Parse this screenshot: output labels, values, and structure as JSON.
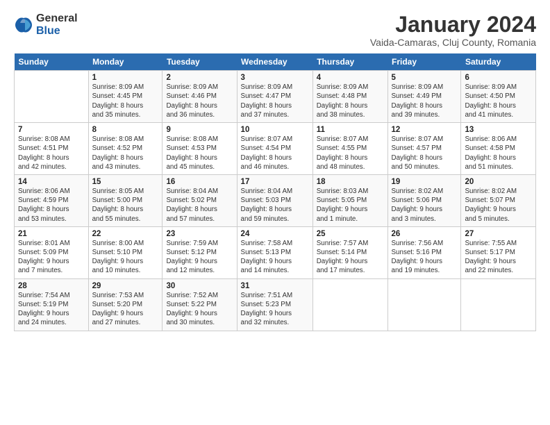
{
  "logo": {
    "general": "General",
    "blue": "Blue"
  },
  "title": "January 2024",
  "subtitle": "Vaida-Camaras, Cluj County, Romania",
  "days_header": [
    "Sunday",
    "Monday",
    "Tuesday",
    "Wednesday",
    "Thursday",
    "Friday",
    "Saturday"
  ],
  "weeks": [
    [
      {
        "num": "",
        "info": ""
      },
      {
        "num": "1",
        "info": "Sunrise: 8:09 AM\nSunset: 4:45 PM\nDaylight: 8 hours\nand 35 minutes."
      },
      {
        "num": "2",
        "info": "Sunrise: 8:09 AM\nSunset: 4:46 PM\nDaylight: 8 hours\nand 36 minutes."
      },
      {
        "num": "3",
        "info": "Sunrise: 8:09 AM\nSunset: 4:47 PM\nDaylight: 8 hours\nand 37 minutes."
      },
      {
        "num": "4",
        "info": "Sunrise: 8:09 AM\nSunset: 4:48 PM\nDaylight: 8 hours\nand 38 minutes."
      },
      {
        "num": "5",
        "info": "Sunrise: 8:09 AM\nSunset: 4:49 PM\nDaylight: 8 hours\nand 39 minutes."
      },
      {
        "num": "6",
        "info": "Sunrise: 8:09 AM\nSunset: 4:50 PM\nDaylight: 8 hours\nand 41 minutes."
      }
    ],
    [
      {
        "num": "7",
        "info": "Sunrise: 8:08 AM\nSunset: 4:51 PM\nDaylight: 8 hours\nand 42 minutes."
      },
      {
        "num": "8",
        "info": "Sunrise: 8:08 AM\nSunset: 4:52 PM\nDaylight: 8 hours\nand 43 minutes."
      },
      {
        "num": "9",
        "info": "Sunrise: 8:08 AM\nSunset: 4:53 PM\nDaylight: 8 hours\nand 45 minutes."
      },
      {
        "num": "10",
        "info": "Sunrise: 8:07 AM\nSunset: 4:54 PM\nDaylight: 8 hours\nand 46 minutes."
      },
      {
        "num": "11",
        "info": "Sunrise: 8:07 AM\nSunset: 4:55 PM\nDaylight: 8 hours\nand 48 minutes."
      },
      {
        "num": "12",
        "info": "Sunrise: 8:07 AM\nSunset: 4:57 PM\nDaylight: 8 hours\nand 50 minutes."
      },
      {
        "num": "13",
        "info": "Sunrise: 8:06 AM\nSunset: 4:58 PM\nDaylight: 8 hours\nand 51 minutes."
      }
    ],
    [
      {
        "num": "14",
        "info": "Sunrise: 8:06 AM\nSunset: 4:59 PM\nDaylight: 8 hours\nand 53 minutes."
      },
      {
        "num": "15",
        "info": "Sunrise: 8:05 AM\nSunset: 5:00 PM\nDaylight: 8 hours\nand 55 minutes."
      },
      {
        "num": "16",
        "info": "Sunrise: 8:04 AM\nSunset: 5:02 PM\nDaylight: 8 hours\nand 57 minutes."
      },
      {
        "num": "17",
        "info": "Sunrise: 8:04 AM\nSunset: 5:03 PM\nDaylight: 8 hours\nand 59 minutes."
      },
      {
        "num": "18",
        "info": "Sunrise: 8:03 AM\nSunset: 5:05 PM\nDaylight: 9 hours\nand 1 minute."
      },
      {
        "num": "19",
        "info": "Sunrise: 8:02 AM\nSunset: 5:06 PM\nDaylight: 9 hours\nand 3 minutes."
      },
      {
        "num": "20",
        "info": "Sunrise: 8:02 AM\nSunset: 5:07 PM\nDaylight: 9 hours\nand 5 minutes."
      }
    ],
    [
      {
        "num": "21",
        "info": "Sunrise: 8:01 AM\nSunset: 5:09 PM\nDaylight: 9 hours\nand 7 minutes."
      },
      {
        "num": "22",
        "info": "Sunrise: 8:00 AM\nSunset: 5:10 PM\nDaylight: 9 hours\nand 10 minutes."
      },
      {
        "num": "23",
        "info": "Sunrise: 7:59 AM\nSunset: 5:12 PM\nDaylight: 9 hours\nand 12 minutes."
      },
      {
        "num": "24",
        "info": "Sunrise: 7:58 AM\nSunset: 5:13 PM\nDaylight: 9 hours\nand 14 minutes."
      },
      {
        "num": "25",
        "info": "Sunrise: 7:57 AM\nSunset: 5:14 PM\nDaylight: 9 hours\nand 17 minutes."
      },
      {
        "num": "26",
        "info": "Sunrise: 7:56 AM\nSunset: 5:16 PM\nDaylight: 9 hours\nand 19 minutes."
      },
      {
        "num": "27",
        "info": "Sunrise: 7:55 AM\nSunset: 5:17 PM\nDaylight: 9 hours\nand 22 minutes."
      }
    ],
    [
      {
        "num": "28",
        "info": "Sunrise: 7:54 AM\nSunset: 5:19 PM\nDaylight: 9 hours\nand 24 minutes."
      },
      {
        "num": "29",
        "info": "Sunrise: 7:53 AM\nSunset: 5:20 PM\nDaylight: 9 hours\nand 27 minutes."
      },
      {
        "num": "30",
        "info": "Sunrise: 7:52 AM\nSunset: 5:22 PM\nDaylight: 9 hours\nand 30 minutes."
      },
      {
        "num": "31",
        "info": "Sunrise: 7:51 AM\nSunset: 5:23 PM\nDaylight: 9 hours\nand 32 minutes."
      },
      {
        "num": "",
        "info": ""
      },
      {
        "num": "",
        "info": ""
      },
      {
        "num": "",
        "info": ""
      }
    ]
  ]
}
